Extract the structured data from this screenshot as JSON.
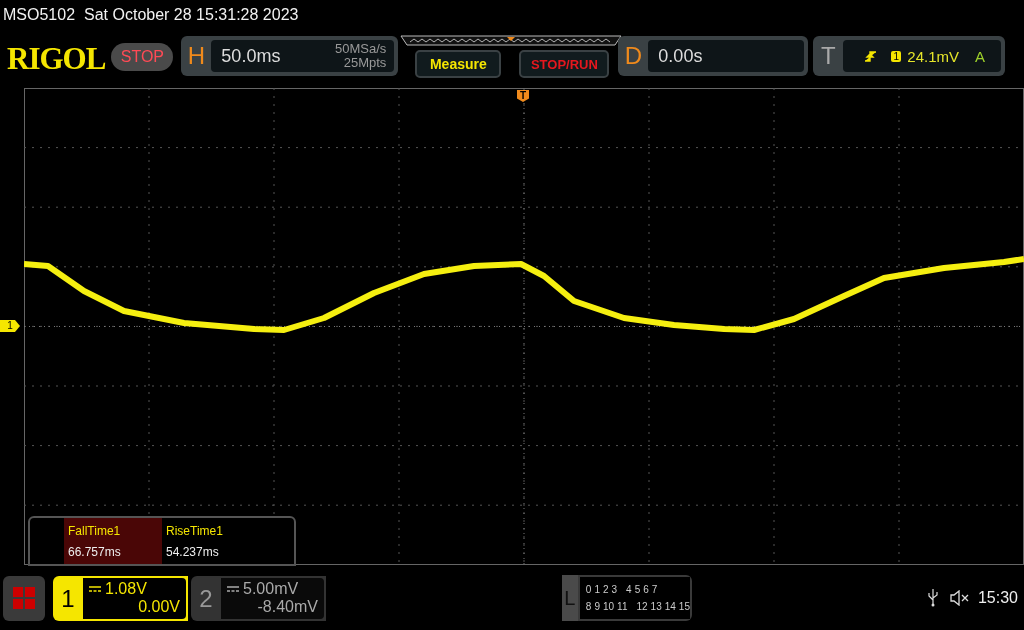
{
  "status_line": {
    "model": "MSO5102",
    "datetime": "Sat October 28 15:31:28 2023"
  },
  "toolbar": {
    "logo": "RIGOL",
    "run_state": "STOP",
    "horizontal": {
      "label": "H",
      "timebase": "50.0ms",
      "sample_rate": "50MSa/s",
      "memory_depth": "25Mpts"
    },
    "measure_button": "Measure",
    "stop_run_button": "STOP/RUN",
    "delay": {
      "label": "D",
      "value": "0.00s"
    },
    "trigger": {
      "label": "T",
      "source": "1",
      "level": "24.1mV",
      "mode": "A"
    }
  },
  "screen": {
    "trigger_marker": "T",
    "channel_marker": "1"
  },
  "measurements": [
    {
      "name": "FallTime1",
      "value": "66.757ms",
      "selected": true
    },
    {
      "name": "RiseTime1",
      "value": "54.237ms",
      "selected": false
    }
  ],
  "channels": [
    {
      "number": "1",
      "scale": "1.08V",
      "offset": "0.00V",
      "active": true
    },
    {
      "number": "2",
      "scale": "5.00mV",
      "offset": "-8.40mV",
      "active": false
    }
  ],
  "logic": {
    "label": "L",
    "rows": [
      {
        "bits": [
          "0",
          "1",
          "2",
          "3",
          "4",
          "5",
          "6",
          "7"
        ]
      },
      {
        "bits": [
          "8",
          "9",
          "10",
          "11",
          "12",
          "13",
          "14",
          "15"
        ]
      }
    ]
  },
  "status": {
    "time": "15:30"
  }
}
